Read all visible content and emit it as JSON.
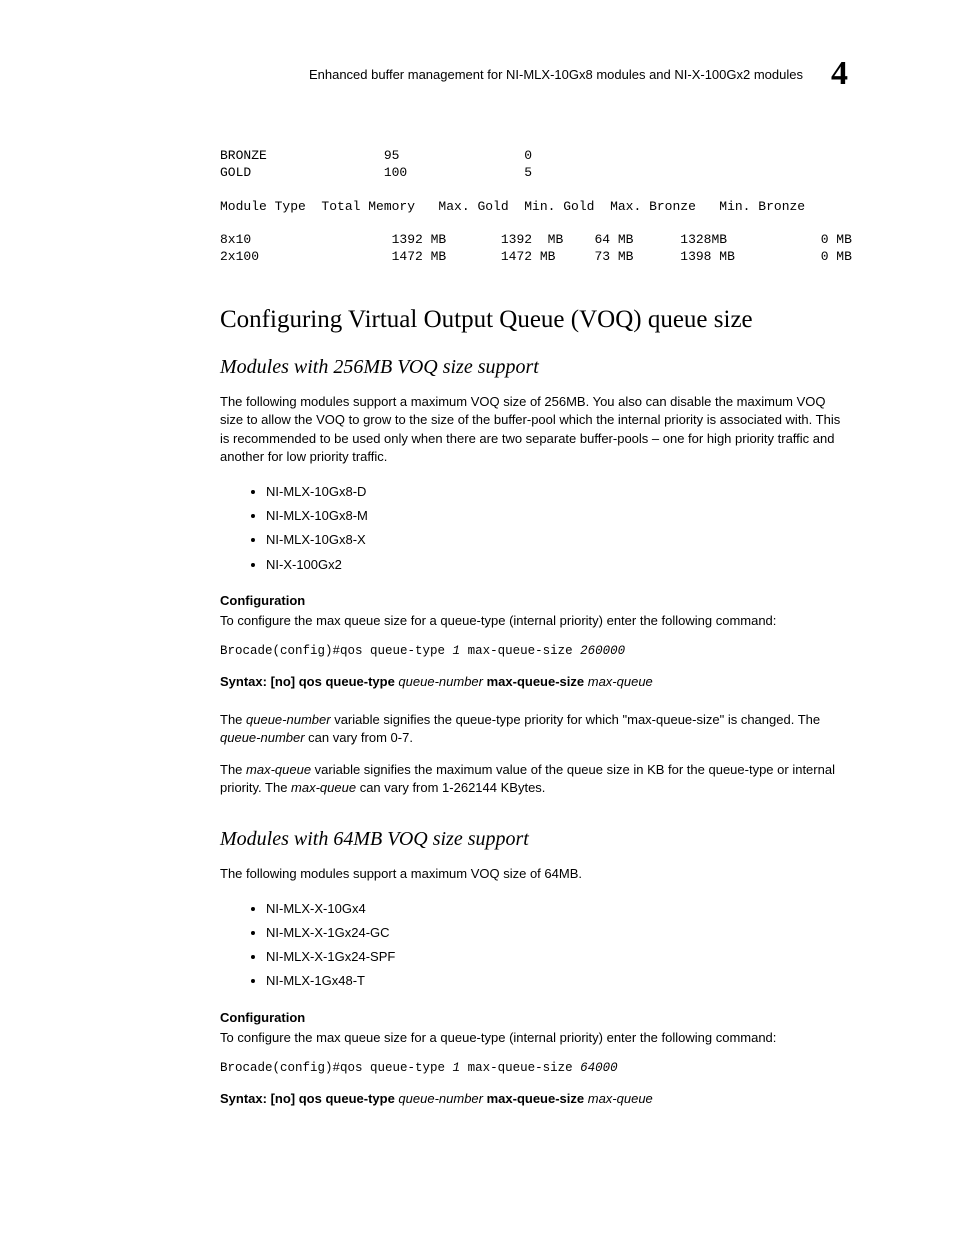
{
  "header": {
    "title": "Enhanced buffer management for NI-MLX-10Gx8 modules and NI-X-100Gx2 modules",
    "page_num": "4"
  },
  "pre_table": {
    "bronze_row": "BRONZE               95                0",
    "gold_row": "GOLD                 100               5",
    "header_row": "Module Type  Total Memory   Max. Gold  Min. Gold  Max. Bronze   Min. Bronze",
    "r1": "8x10                  1392 MB       1392  MB    64 MB      1328MB            0 MB",
    "r2": "2x100                 1472 MB       1472 MB     73 MB      1398 MB           0 MB"
  },
  "section": {
    "title": "Configuring Virtual Output Queue (VOQ) queue size"
  },
  "sub256": {
    "title": "Modules with 256MB VOQ size support",
    "para": "The following modules support a maximum VOQ size of 256MB.  You also can disable the maximum VOQ size to allow the VOQ to grow to the size of the buffer-pool which the internal priority is associated with. This is recommended to be used only when there are two separate buffer-pools – one for high priority traffic and another for low priority traffic.",
    "list": [
      "NI-MLX-10Gx8-D",
      "NI-MLX-10Gx8-M",
      "NI-MLX-10Gx8-X",
      "NI-X-100Gx2"
    ],
    "config_head": "Configuration",
    "config_text": "To configure the max queue size for a queue-type (internal priority) enter the following command:",
    "cmd_prefix": "Brocade(config)#qos queue-type ",
    "cmd_arg1": "1",
    "cmd_mid": " max-queue-size ",
    "cmd_arg2": "260000",
    "syntax_label": "Syntax:  ",
    "syntax_bold1": "[no] qos queue-type ",
    "syntax_ital1": "queue-number",
    "syntax_bold2": " max-queue-size ",
    "syntax_ital2": "max-queue",
    "para2a": "The ",
    "para2b": "queue-number",
    "para2c": " variable signifies the queue-type priority for which \"max-queue-size\" is changed. The ",
    "para2d": "queue-number",
    "para2e": " can vary from 0-7.",
    "para3a": "The ",
    "para3b": "max-queue",
    "para3c": " variable signifies the maximum value of the queue size in KB for the queue-type or internal priority. The ",
    "para3d": "max-queue",
    "para3e": " can vary from 1-262144 KBytes."
  },
  "sub64": {
    "title": "Modules with 64MB VOQ size support",
    "para": "The following modules support a maximum VOQ size of 64MB.",
    "list": [
      "NI-MLX-X-10Gx4",
      "NI-MLX-X-1Gx24-GC",
      "NI-MLX-X-1Gx24-SPF",
      "NI-MLX-1Gx48-T"
    ],
    "config_head": "Configuration",
    "config_text": "To configure the max queue size for a queue-type (internal priority) enter the following command:",
    "cmd_prefix": "Brocade(config)#qos queue-type ",
    "cmd_arg1": "1",
    "cmd_mid": " max-queue-size ",
    "cmd_arg2": "64000",
    "syntax_label": "Syntax:  ",
    "syntax_bold1": "[no] qos queue-type ",
    "syntax_ital1": "queue-number",
    "syntax_bold2": " max-queue-size ",
    "syntax_ital2": "max-queue"
  }
}
